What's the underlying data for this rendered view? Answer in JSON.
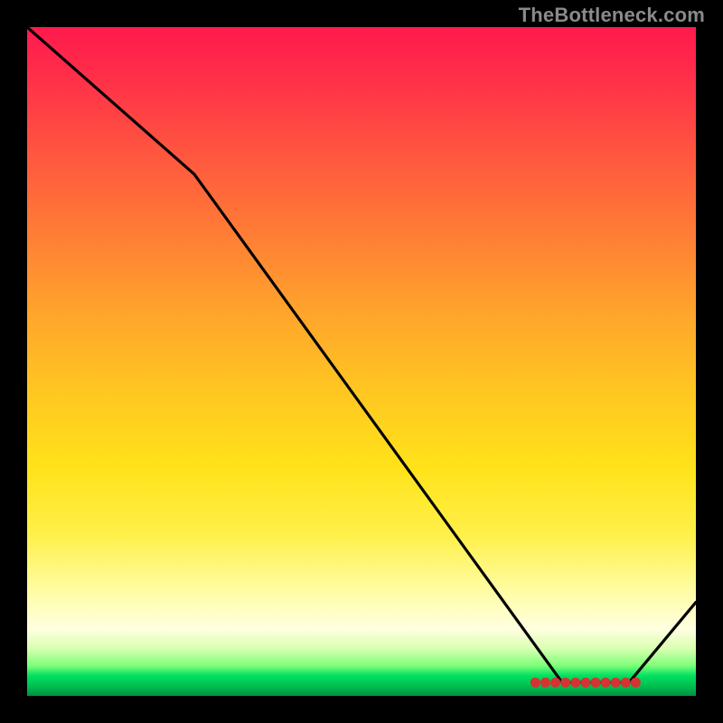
{
  "attribution": "TheBottleneck.com",
  "chart_data": {
    "type": "line",
    "title": "",
    "xlabel": "",
    "ylabel": "",
    "xlim": [
      0,
      100
    ],
    "ylim": [
      0,
      100
    ],
    "grid": false,
    "legend": false,
    "series": [
      {
        "name": "curve",
        "x": [
          0,
          25,
          80,
          90,
          100
        ],
        "values": [
          100,
          78,
          2,
          2,
          14
        ]
      }
    ],
    "markers": {
      "name": "optimum-band",
      "color": "#d63333",
      "x": [
        76,
        77.5,
        79,
        80.5,
        82,
        83.5,
        85,
        86.5,
        88,
        89.5,
        91
      ],
      "values": [
        2,
        2,
        2,
        2,
        2,
        2,
        2,
        2,
        2,
        2,
        2
      ]
    },
    "gradient_stops": [
      {
        "pos": 0,
        "color": "#ff1a4d"
      },
      {
        "pos": 6,
        "color": "#ff2a4a"
      },
      {
        "pos": 18,
        "color": "#ff5340"
      },
      {
        "pos": 30,
        "color": "#ff7a36"
      },
      {
        "pos": 42,
        "color": "#ffa22c"
      },
      {
        "pos": 54,
        "color": "#ffc522"
      },
      {
        "pos": 66,
        "color": "#ffe31a"
      },
      {
        "pos": 76,
        "color": "#fff04a"
      },
      {
        "pos": 84,
        "color": "#fffca0"
      },
      {
        "pos": 90,
        "color": "#ffffe0"
      },
      {
        "pos": 93,
        "color": "#d8ffb0"
      },
      {
        "pos": 95.5,
        "color": "#7cff78"
      },
      {
        "pos": 97,
        "color": "#00e060"
      },
      {
        "pos": 98.5,
        "color": "#00c050"
      },
      {
        "pos": 100,
        "color": "#009040"
      }
    ]
  }
}
